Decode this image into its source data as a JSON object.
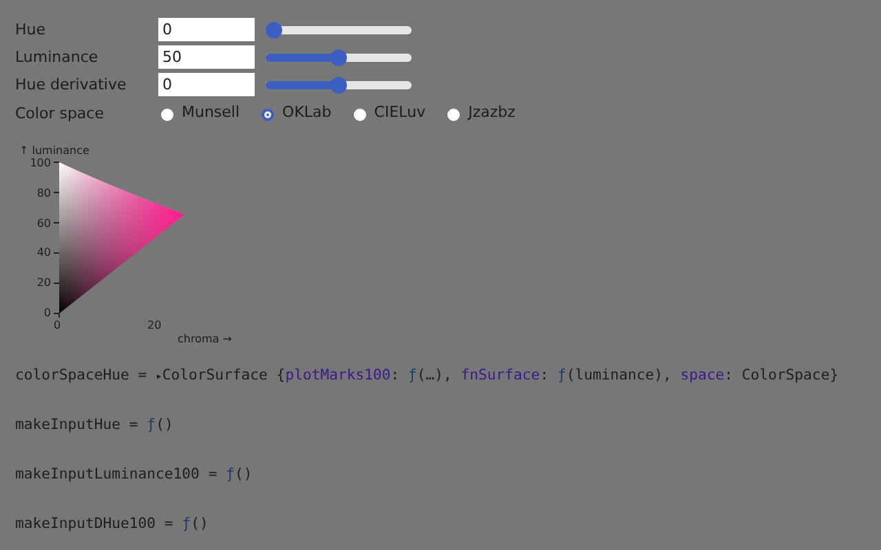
{
  "inputs": [
    {
      "label": "Hue",
      "value": "0",
      "level": 0
    },
    {
      "label": "Luminance",
      "value": "50",
      "level": 0.5
    },
    {
      "label": "Hue derivative",
      "value": "0",
      "level": 0.5
    }
  ],
  "color_space": {
    "label": "Color space",
    "options": [
      {
        "label": "Munsell",
        "selected": false
      },
      {
        "label": "OKLab",
        "selected": true
      },
      {
        "label": "CIELuv",
        "selected": false
      },
      {
        "label": "Jzazbz",
        "selected": false
      }
    ]
  },
  "plot": {
    "y_label": "↑ luminance",
    "y_ticks": [
      "100",
      "80",
      "60",
      "40",
      "20",
      "0"
    ],
    "x_ticks": [
      "0",
      "20"
    ],
    "x_label": "chroma →"
  },
  "cells": [
    [
      {
        "kind": "plain",
        "text": "colorSpaceHue = "
      },
      {
        "kind": "toggle",
        "text": "▸"
      },
      {
        "kind": "plain",
        "text": "ColorSurface {"
      },
      {
        "kind": "key",
        "text": "plotMarks100"
      },
      {
        "kind": "plain",
        "text": ": "
      },
      {
        "kind": "fn",
        "text": "ƒ"
      },
      {
        "kind": "plain",
        "text": "(…), "
      },
      {
        "kind": "key",
        "text": "fnSurface"
      },
      {
        "kind": "plain",
        "text": ": "
      },
      {
        "kind": "fn",
        "text": "ƒ"
      },
      {
        "kind": "plain",
        "text": "(luminance), "
      },
      {
        "kind": "key",
        "text": "space"
      },
      {
        "kind": "plain",
        "text": ": ColorSpace}"
      }
    ],
    [
      {
        "kind": "plain",
        "text": "makeInputHue = "
      },
      {
        "kind": "fn",
        "text": "ƒ"
      },
      {
        "kind": "plain",
        "text": "()"
      }
    ],
    [
      {
        "kind": "plain",
        "text": "makeInputLuminance100 = "
      },
      {
        "kind": "fn",
        "text": "ƒ"
      },
      {
        "kind": "plain",
        "text": "()"
      }
    ],
    [
      {
        "kind": "plain",
        "text": "makeInputDHue100 = "
      },
      {
        "kind": "fn",
        "text": "ƒ"
      },
      {
        "kind": "plain",
        "text": "()"
      }
    ]
  ]
}
